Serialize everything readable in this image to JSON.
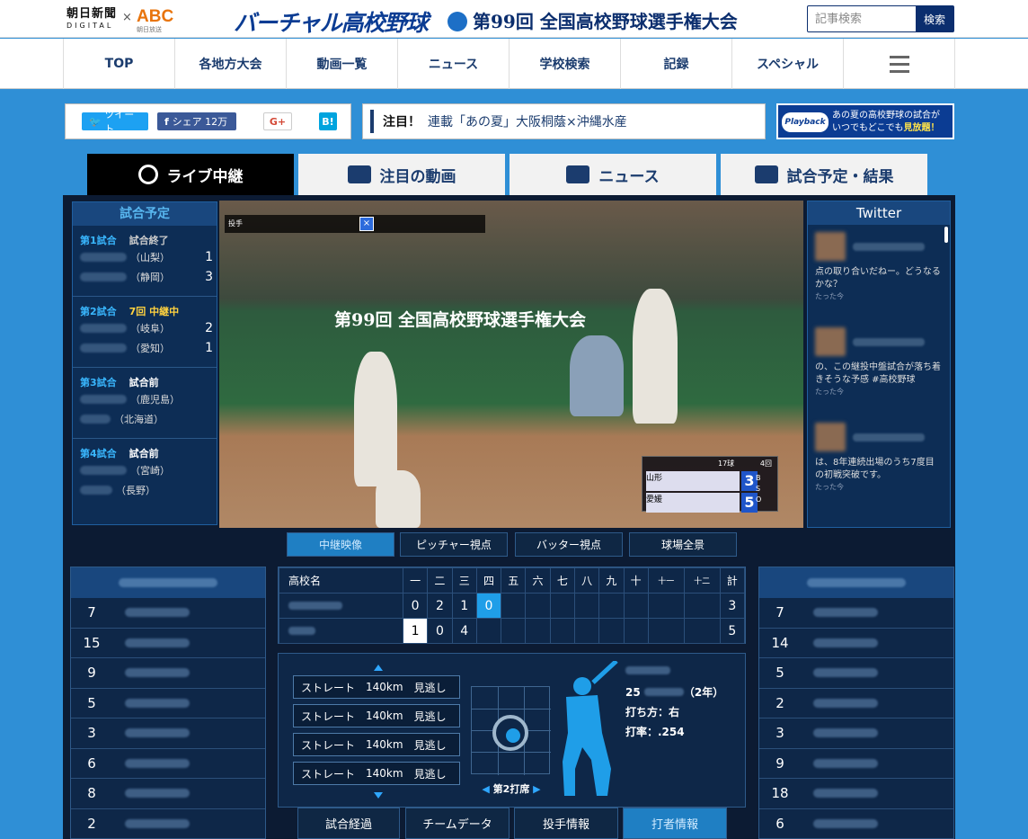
{
  "header": {
    "logo_asahi": "朝日新聞",
    "logo_asahi_sub": "DIGITAL",
    "logo_cross": "×",
    "logo_abc": "ABC",
    "logo_abc_sub": "朝日放送",
    "logo_virtual": "バーチャル高校野球",
    "logo_tournament": "第99回 全国高校野球選手権大会",
    "search_placeholder": "記事検索",
    "search_button": "検索"
  },
  "nav": {
    "items": [
      "TOP",
      "各地方大会",
      "動画一覧",
      "ニュース",
      "学校検索",
      "記録",
      "スペシャル"
    ]
  },
  "share": {
    "tweet": "ツイート",
    "facebook": "シェア 12万",
    "gplus": "G+",
    "hatena": "B!"
  },
  "notice": {
    "label": "注目！",
    "text": "連載「あの夏」大阪桐蔭×沖縄水産"
  },
  "playback": {
    "logo": "Playback",
    "line1": "あの夏の高校野球の試合が",
    "line2": "いつでもどこでも",
    "line2_emph": "見放題！"
  },
  "tabs": [
    "ライブ中継",
    "注目の動画",
    "ニュース",
    "試合予定・結果"
  ],
  "schedule": {
    "title": "試合予定",
    "games": [
      {
        "label": "第1試合",
        "status": "試合終了",
        "teams": [
          {
            "pref": "（山梨）",
            "score": "1"
          },
          {
            "pref": "（静岡）",
            "score": "3"
          }
        ]
      },
      {
        "label": "第2試合",
        "status": "7回 中継中",
        "teams": [
          {
            "pref": "（岐阜）",
            "score": "2"
          },
          {
            "pref": "（愛知）",
            "score": "1"
          }
        ]
      },
      {
        "label": "第3試合",
        "status": "試合前",
        "teams": [
          {
            "pref": "（鹿児島）",
            "score": ""
          },
          {
            "pref": "（北海道）",
            "score": ""
          }
        ]
      },
      {
        "label": "第4試合",
        "status": "試合前",
        "teams": [
          {
            "pref": "（宮崎）",
            "score": ""
          },
          {
            "pref": "（長野）",
            "score": ""
          }
        ]
      }
    ]
  },
  "video": {
    "banner": "第99回 全国高校野球選手権大会",
    "pitcher_label": "投手",
    "x_mark": "×",
    "inning": "17球",
    "inning_top": "4回",
    "away_pref": "山形",
    "home_pref": "愛媛",
    "away_score": "3",
    "home_score": "5",
    "bso": [
      "B",
      "S",
      "O"
    ]
  },
  "twitter": {
    "title": "Twitter",
    "tweets": [
      {
        "text": "点の取り合いだねー。どうなるかな？",
        "time": "たった今"
      },
      {
        "text": "の、この継投中盤試合が落ち着きそうな予感 #高校野球",
        "time": "たった今"
      },
      {
        "text": "は、8年連続出場のうち7度目の初戦突破です。",
        "time": "たった今"
      }
    ]
  },
  "camera_tabs": [
    "中継映像",
    "ピッチャー視点",
    "バッター視点",
    "球場全景"
  ],
  "lineup_left": [
    "7",
    "15",
    "9",
    "5",
    "3",
    "6",
    "8",
    "2"
  ],
  "lineup_right": [
    "7",
    "14",
    "5",
    "2",
    "3",
    "9",
    "18",
    "6"
  ],
  "scoreboard": {
    "header_label": "高校名",
    "innings": [
      "一",
      "二",
      "三",
      "四",
      "五",
      "六",
      "七",
      "八",
      "九",
      "十",
      "十一",
      "十二",
      "計"
    ],
    "rows": [
      {
        "scores": [
          "0",
          "2",
          "1",
          "0",
          "",
          "",
          "",
          "",
          "",
          "",
          "",
          "",
          "3"
        ]
      },
      {
        "scores": [
          "1",
          "0",
          "4",
          "",
          "",
          "",
          "",
          "",
          "",
          "",
          "",
          "",
          "5"
        ]
      }
    ]
  },
  "pitches": {
    "items": [
      {
        "type": "ストレート",
        "speed": "140km",
        "result": "見逃し"
      },
      {
        "type": "ストレート",
        "speed": "140km",
        "result": "見逃し"
      },
      {
        "type": "ストレート",
        "speed": "140km",
        "result": "見逃し"
      },
      {
        "type": "ストレート",
        "speed": "140km",
        "result": "見逃し"
      }
    ],
    "at_bat": "第2打席"
  },
  "batter": {
    "number": "25",
    "grade": "（2年）",
    "bats": "打ち方：右",
    "avg": "打率：.254"
  },
  "bottom_tabs": [
    "試合経過",
    "チームデータ",
    "投手情報",
    "打者情報"
  ],
  "colors": {
    "accent": "#1f9ee8",
    "navy": "#0b2e6e",
    "panel": "#0e2748"
  }
}
